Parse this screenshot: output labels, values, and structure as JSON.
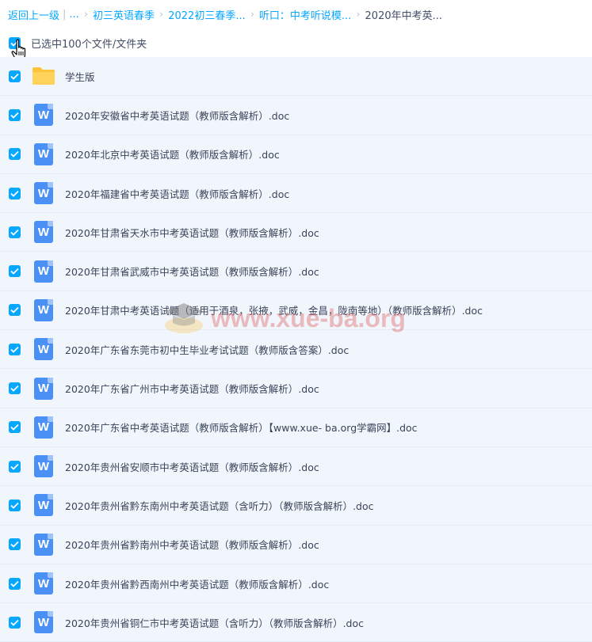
{
  "breadcrumb": {
    "back": "返回上一级",
    "ellipsis": "...",
    "items": [
      "初三英语春季",
      "2022初三春季...",
      "听口：中考听说模...",
      "2020年中考英..."
    ]
  },
  "selection": {
    "label": "已选中100个文件/文件夹"
  },
  "files": [
    {
      "name": "学生版",
      "type": "folder-icon"
    },
    {
      "name": "2020年安徽省中考英语试题（教师版含解析）.doc",
      "type": "word-icon"
    },
    {
      "name": "2020年北京中考英语试题（教师版含解析）.doc",
      "type": "word-icon"
    },
    {
      "name": "2020年福建省中考英语试题（教师版含解析）.doc",
      "type": "word-icon"
    },
    {
      "name": "2020年甘肃省天水市中考英语试题（教师版含解析）.doc",
      "type": "word-icon"
    },
    {
      "name": "2020年甘肃省武威市中考英语试题（教师版含解析）.doc",
      "type": "word-icon"
    },
    {
      "name": "2020年甘肃中考英语试题（适用于酒泉，张掖，武威，金昌，陇南等地）（教师版含解析）.doc",
      "type": "word-icon"
    },
    {
      "name": "2020年广东省东莞市初中生毕业考试试题（教师版含答案）.doc",
      "type": "word-icon"
    },
    {
      "name": "2020年广东省广州市中考英语试题（教师版含解析）.doc",
      "type": "word-icon"
    },
    {
      "name": "2020年广东省中考英语试题（教师版含解析）【www.xue- ba.org学霸网】.doc",
      "type": "word-icon"
    },
    {
      "name": "2020年贵州省安顺市中考英语试题（教师版含解析）.doc",
      "type": "word-icon"
    },
    {
      "name": "2020年贵州省黔东南州中考英语试题（含听力）（教师版含解析）.doc",
      "type": "word-icon"
    },
    {
      "name": "2020年贵州省黔南州中考英语试题（教师版含解析）.doc",
      "type": "word-icon"
    },
    {
      "name": "2020年贵州省黔西南州中考英语试题（教师版含解析）.doc",
      "type": "word-icon"
    },
    {
      "name": "2020年贵州省铜仁市中考英语试题（含听力）（教师版含解析）.doc",
      "type": "word-icon"
    }
  ],
  "watermark": "www.xue-ba.org",
  "colors": {
    "accent": "#06a7ff",
    "list_bg": "#f1f6fd",
    "word": "#4a90f5",
    "folder": "#fdc33c"
  }
}
